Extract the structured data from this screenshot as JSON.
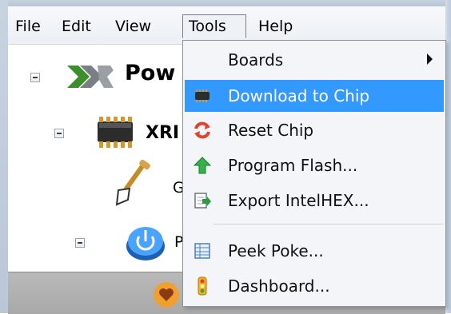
{
  "menubar": {
    "items": [
      {
        "label": "File"
      },
      {
        "label": "Edit"
      },
      {
        "label": "View"
      },
      {
        "label": "Tools",
        "open": true
      },
      {
        "label": "Help"
      }
    ]
  },
  "tree": {
    "root_label": "Pow",
    "device_label": "XRI",
    "child1_label": "G",
    "child2_label": "P"
  },
  "tools_menu": {
    "items": [
      {
        "label": "Boards",
        "icon": "none",
        "submenu": true
      },
      {
        "label": "Download to Chip",
        "icon": "chip-icon",
        "highlighted": true
      },
      {
        "label": "Reset Chip",
        "icon": "reset-icon"
      },
      {
        "label": "Program Flash...",
        "icon": "green-arrow-up-icon"
      },
      {
        "label": "Export IntelHEX...",
        "icon": "export-icon"
      },
      {
        "label": "Peek Poke...",
        "icon": "table-icon"
      },
      {
        "label": "Dashboard...",
        "icon": "traffic-light-icon"
      }
    ]
  },
  "colors": {
    "highlight": "#3399ff",
    "menu_bg": "#f3f5f8"
  }
}
